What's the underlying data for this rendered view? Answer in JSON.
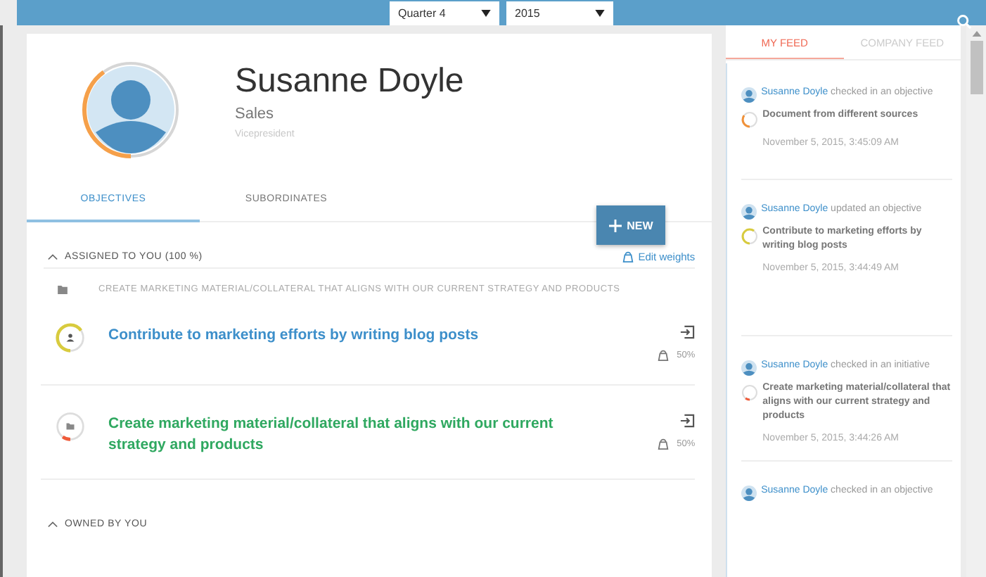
{
  "top_bar": {
    "quarter": "Quarter 4",
    "year": "2015"
  },
  "profile": {
    "name": "Susanne Doyle",
    "department": "Sales",
    "role": "Vicepresident",
    "level": 0.4
  },
  "tabs": [
    {
      "label": "OBJECTIVES",
      "selected": true
    },
    {
      "label": "SUBORDINATES",
      "selected": false
    }
  ],
  "new_button": "NEW",
  "assigned": {
    "title": "ASSIGNED TO YOU (100 %)",
    "expanded": true,
    "edit_link": "Edit weights",
    "parent": "CREATE MARKETING MATERIAL/COLLATERAL THAT ALIGNS WITH OUR CURRENT STRATEGY AND PRODUCTS",
    "items": [
      {
        "kind": "person",
        "title": "Contribute to marketing efforts by writing blog posts",
        "color": "#d8cb3e",
        "level": 0.65,
        "weight": "50%"
      },
      {
        "kind": "folder",
        "title": "Create marketing material/collateral that aligns with our current strategy and products",
        "color": "#ef5b3a",
        "level": 0.1,
        "weight": "50%"
      }
    ]
  },
  "owned": {
    "title": "OWNED BY YOU",
    "expanded": true
  },
  "feed_tabs": [
    {
      "label": "MY FEED",
      "selected": true
    },
    {
      "label": "COMPANY FEED",
      "selected": false
    }
  ],
  "feed": [
    {
      "actor": "Susanne Doyle",
      "action": "checked in an objective",
      "title": "Document from different sources",
      "time": "November 5, 2015, 3:45:09 AM",
      "color": "#f0923a",
      "level": 0.35
    },
    {
      "actor": "Susanne Doyle",
      "action": "updated an objective",
      "title": "Contribute to marketing efforts by writing blog posts",
      "time": "November 5, 2015, 3:44:49 AM",
      "color": "#d8cb3e",
      "level": 0.6
    },
    {
      "actor": "Susanne Doyle",
      "action": "checked in an initiative",
      "title": "Create marketing material/collateral that aligns with our current strategy and products",
      "time": "November 5, 2015, 3:44:26 AM",
      "color": "#ef5b3a",
      "level": 0.1
    },
    {
      "actor": "Susanne Doyle",
      "action": "checked in an objective"
    }
  ]
}
